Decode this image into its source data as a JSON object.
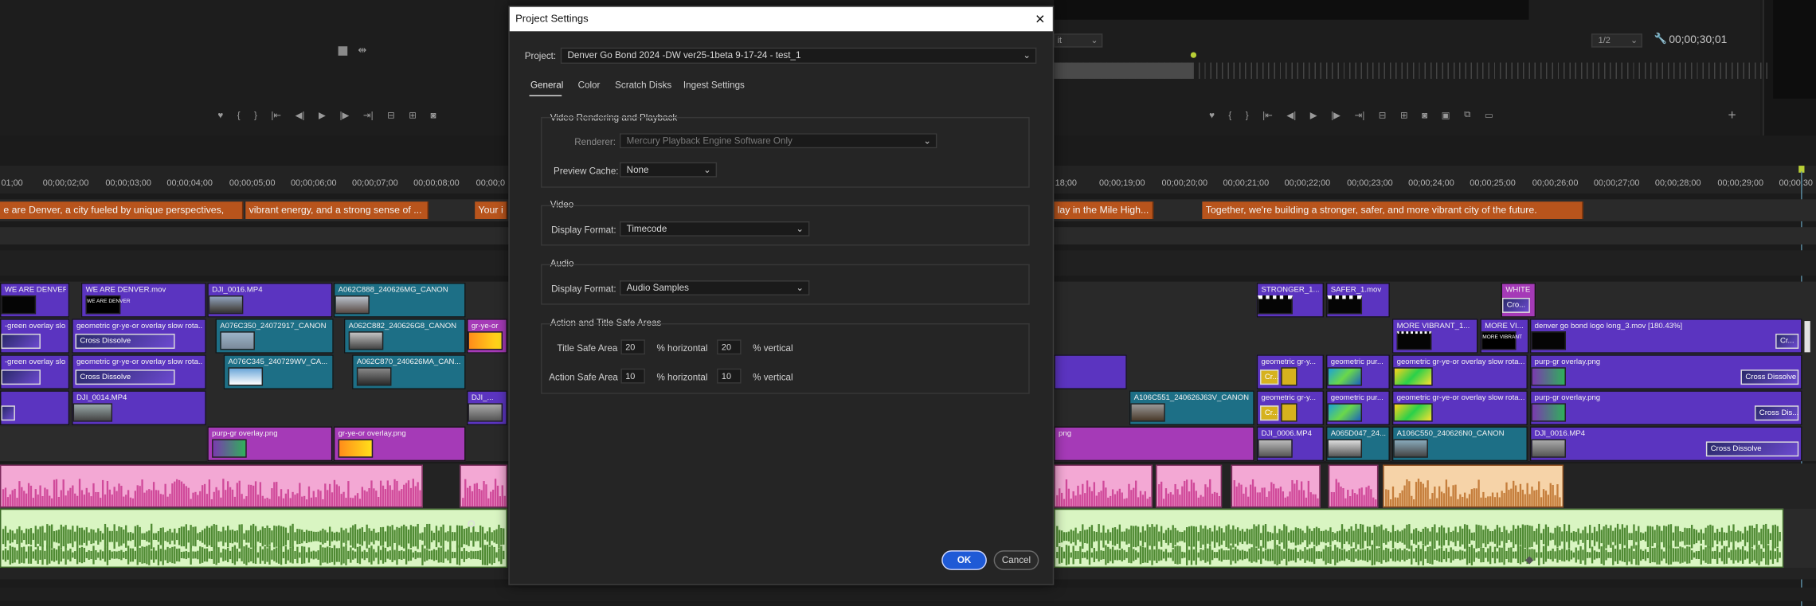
{
  "dialog": {
    "title": "Project Settings",
    "project_label": "Project:",
    "project_value": "Denver Go Bond 2024 -DW ver25-1beta 9-17-24 - test_1",
    "tabs": [
      "General",
      "Color",
      "Scratch Disks",
      "Ingest Settings"
    ],
    "active_tab": "General",
    "video_rendering": {
      "heading": "Video Rendering and Playback",
      "renderer_label": "Renderer:",
      "renderer_value": "Mercury Playback Engine Software Only",
      "preview_cache_label": "Preview Cache:",
      "preview_cache_value": "None"
    },
    "video": {
      "heading": "Video",
      "display_format_label": "Display Format:",
      "display_format_value": "Timecode"
    },
    "audio": {
      "heading": "Audio",
      "display_format_label": "Display Format:",
      "display_format_value": "Audio Samples"
    },
    "safe_areas": {
      "heading": "Action and Title Safe Areas",
      "title_label": "Title Safe Area",
      "title_h": "20",
      "title_v": "20",
      "action_label": "Action Safe Area",
      "action_h": "10",
      "action_v": "10",
      "h_unit": "% horizontal",
      "v_unit": "% vertical"
    },
    "ok": "OK",
    "cancel": "Cancel"
  },
  "monitor": {
    "zoom": "1/2",
    "timecode": "00;00;30;01",
    "partial_label": "it"
  },
  "ruler_ticks": [
    "01;00",
    "00;00;02;00",
    "00;00;03;00",
    "00;00;04;00",
    "00;00;05;00",
    "00;00;06;00",
    "00;00;07;00",
    "00;00;08;00",
    "00;00;0",
    "18;00",
    "00;00;19;00",
    "00;00;20;00",
    "00;00;21;00",
    "00;00;22;00",
    "00;00;23;00",
    "00;00;24;00",
    "00;00;25;00",
    "00;00;26;00",
    "00;00;27;00",
    "00;00;28;00",
    "00;00;29;00",
    "00;00;30"
  ],
  "captions": [
    "e are Denver, a city fueled by unique perspectives,",
    "vibrant energy, and a strong sense of ...",
    "Your i",
    "lay in the Mile High...",
    "Together, we're building a stronger, safer, and more vibrant city of the future."
  ],
  "clips": {
    "c1": "WE ARE DENVER.mov",
    "c2": "WE ARE DENVER.mov",
    "c3": "DJI_0016.MP4",
    "c4": "A062C888_240626MG_CANON",
    "c5": "STRONGER_1...",
    "c6": "SAFER_1.mov",
    "c7": "WHITE",
    "c7b": "Cro...",
    "r2a": "-green overlay slo...",
    "r2b": "geometric gr-ye-or overlay slow rota...",
    "r2c": "A076C350_24072917_CANON",
    "r2d": "A062C882_240626G8_CANON",
    "r2e": "gr-ye-or",
    "r2f": "MORE VIBRANT_1...",
    "r2g": "MORE VI...",
    "r2h": "denver go bond logo long_3.mov [180.43%]",
    "r2i": "Cr...",
    "r3a": "-green overlay slo...",
    "r3b": "geometric gr-ye-or overlay slow rota...",
    "r3c": "A076C345_240729WV_CA...",
    "r3d": "A062C870_240626MA_CAN...",
    "r3e": "geometric gr-y...",
    "r3f": "geometric pur...",
    "r3g": "geometric gr-ye-or overlay slow rota...",
    "r3h": "purp-gr overlay.png",
    "r4a": "DJI_0014.MP4",
    "r4b": "DJI_...",
    "r4c": "A106C551_240626J63V_CANON",
    "r4d": "geometric gr-y...",
    "r4e": "geometric pur...",
    "r4f": "geometric gr-ye-or overlay slow rota...",
    "r4g": "purp-gr overlay.png",
    "r4h": "Cross Dis...",
    "r5a": "purp-gr overlay.png",
    "r5b": "gr-ye-or overlay.png",
    "r5c": "png",
    "r5d": "DJI_0006.MP4",
    "r5e": "A065D047_24...",
    "r5f": "A106C550_240626N0_CANON",
    "r5g": "DJI_0016.MP4",
    "cross_dissolve": "Cross Dissolve",
    "cr_short": "Cr...",
    "logo_we": "WE ARE DENVER",
    "logo_more": "MORE VIBRANT"
  },
  "colors": {
    "caption": "#b8541c",
    "violet": "#5b34c0",
    "teal": "#1d6f86",
    "magenta": "#a53ab7",
    "pink_audio": "#d35aa6",
    "green_audio": "#9ed07a",
    "orange_audio": "#c57e3c"
  }
}
